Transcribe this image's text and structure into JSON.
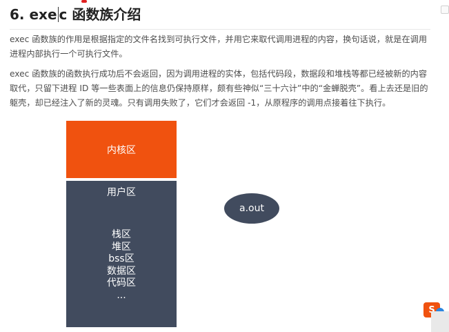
{
  "article": {
    "heading": "6. exec 函数族介绍",
    "heading_part1": "6. exe",
    "heading_part2": "c 函数族介绍",
    "paragraph1": "exec 函数族的作用是根据指定的文件名找到可执行文件，并用它来取代调用进程的内容，换句话说，就是在调用进程内部执行一个可执行文件。",
    "paragraph2": "exec 函数族的函数执行成功后不会返回，因为调用进程的实体，包括代码段，数据段和堆栈等都已经被新的内容取代，只留下进程 ID 等一些表面上的信息仍保持原样，颇有些神似“三十六计”中的“金蝉脱壳”。看上去还是旧的躯壳，却已经注入了新的灵魂。只有调用失败了，它们才会返回 -1，从原程序的调用点接着往下执行。"
  },
  "diagram": {
    "kernel_label": "内核区",
    "user_label": "用户区",
    "segments": [
      "栈区",
      "堆区",
      "bss区",
      "数据区",
      "代码区",
      "..."
    ],
    "program_label": "a.out",
    "colors": {
      "kernel": "#f0520f",
      "user": "#414b5e",
      "program": "#414b5e"
    }
  },
  "widget": {
    "icon": "sogou-input-icon",
    "letter": "S"
  }
}
